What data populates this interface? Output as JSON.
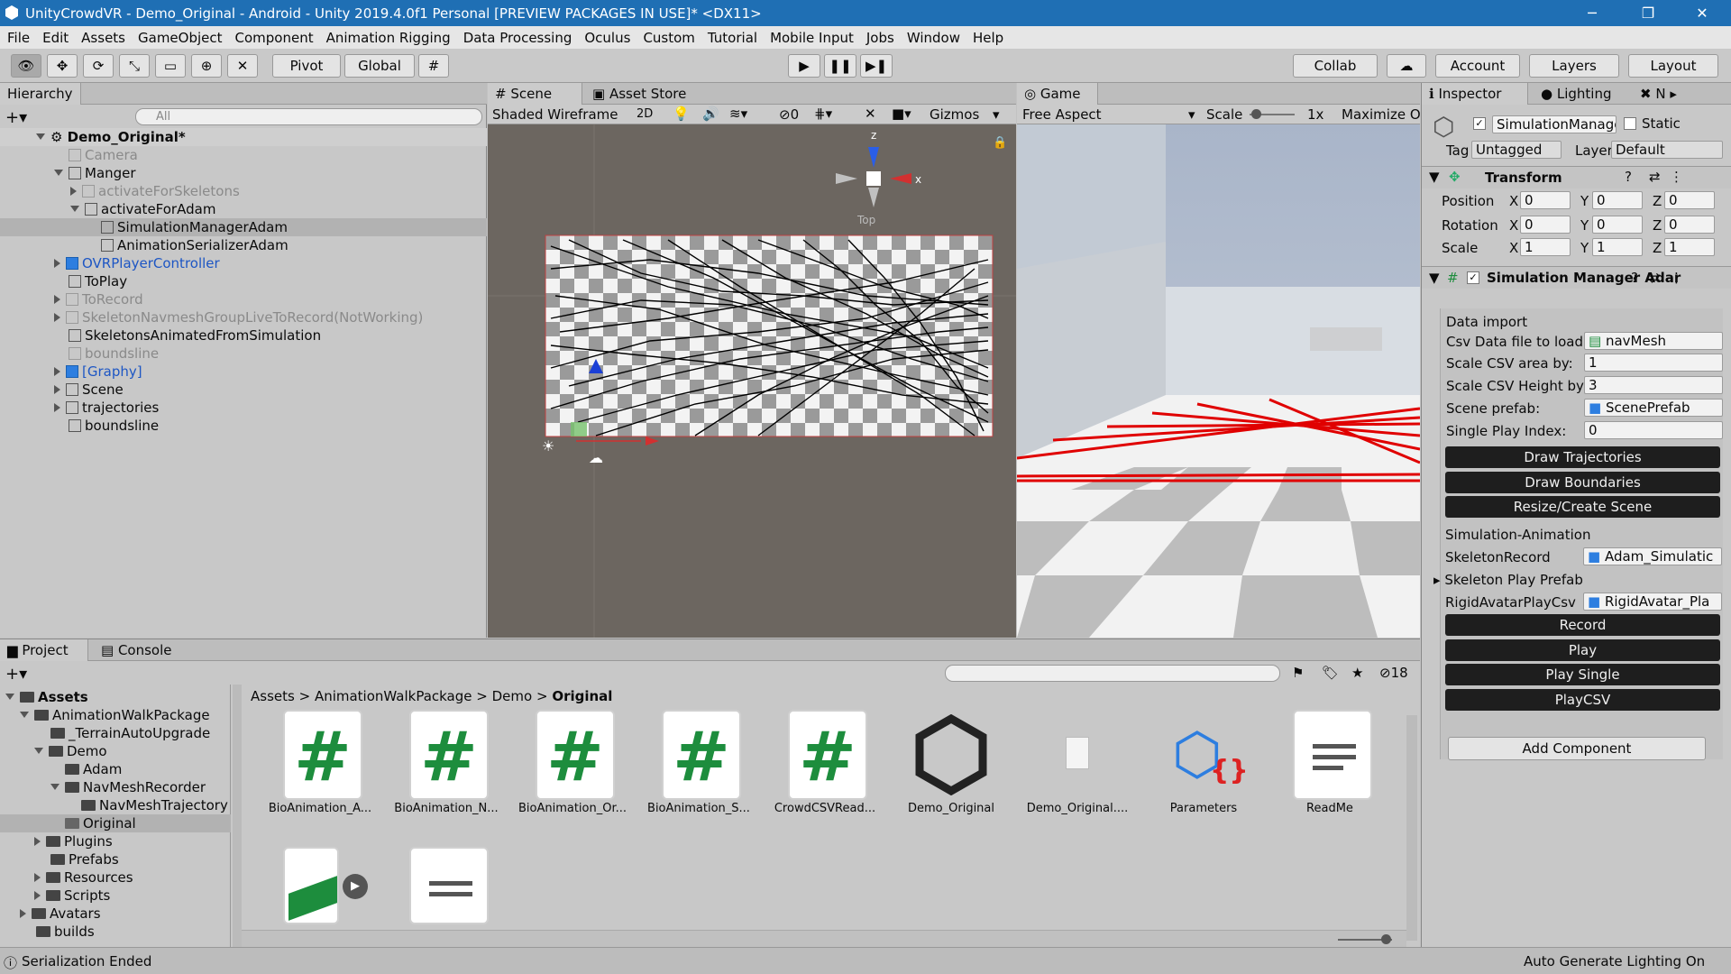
{
  "titlebar": {
    "title": "UnityCrowdVR - Demo_Original - Android - Unity 2019.4.0f1 Personal [PREVIEW PACKAGES IN USE]* <DX11>",
    "minimize": "─",
    "restore": "❐",
    "close": "✕"
  },
  "menu": [
    "File",
    "Edit",
    "Assets",
    "GameObject",
    "Component",
    "Animation Rigging",
    "Data Processing",
    "Oculus",
    "Custom",
    "Tutorial",
    "Mobile Input",
    "Jobs",
    "Window",
    "Help"
  ],
  "toolbar": {
    "pivot": "Pivot",
    "global": "Global",
    "collab": "Collab",
    "account": "Account",
    "layers": "Layers",
    "layout": "Layout"
  },
  "hierarchy": {
    "tab": "Hierarchy",
    "search_placeholder": "All",
    "items": [
      {
        "label": "Demo_Original*",
        "style": "root"
      },
      {
        "label": "Camera",
        "style": "dim"
      },
      {
        "label": "Manger",
        "style": "normal"
      },
      {
        "label": "activateForSkeletons",
        "style": "dim"
      },
      {
        "label": "activateForAdam",
        "style": "normal"
      },
      {
        "label": "SimulationManagerAdam",
        "style": "normal"
      },
      {
        "label": "AnimationSerializerAdam",
        "style": "normal"
      },
      {
        "label": "OVRPlayerController",
        "style": "link"
      },
      {
        "label": "ToPlay",
        "style": "normal"
      },
      {
        "label": "ToRecord",
        "style": "dim"
      },
      {
        "label": "SkeletonNavmeshGroupLiveToRecord(NotWorking)",
        "style": "dim"
      },
      {
        "label": "SkeletonsAnimatedFromSimulation",
        "style": "normal"
      },
      {
        "label": "boundsline",
        "style": "dim"
      },
      {
        "label": "[Graphy]",
        "style": "link"
      },
      {
        "label": "Scene",
        "style": "normal"
      },
      {
        "label": "trajectories",
        "style": "normal"
      },
      {
        "label": "boundsline",
        "style": "normal"
      }
    ]
  },
  "scene": {
    "tab": "Scene",
    "tab2": "Asset Store",
    "shading": "Shaded Wireframe",
    "mode2d": "2D",
    "hidden_count": "0",
    "gizmos": "Gizmos",
    "axis_z": "z",
    "axis_x": "x",
    "view_label": "Top"
  },
  "game": {
    "tab": "Game",
    "aspect": "Free Aspect",
    "scale_label": "Scale",
    "scale_value": "1x",
    "maximize": "Maximize O"
  },
  "inspector": {
    "tab": "Inspector",
    "tab2": "Lighting",
    "tab3": "N",
    "object_name": "SimulationManagerAd",
    "static": "Static",
    "tag_label": "Tag",
    "tag": "Untagged",
    "layer_label": "Layer",
    "layer": "Default",
    "transform": {
      "title": "Transform",
      "rows": [
        {
          "label": "Position",
          "x": "0",
          "y": "0",
          "z": "0"
        },
        {
          "label": "Rotation",
          "x": "0",
          "y": "0",
          "z": "0"
        },
        {
          "label": "Scale",
          "x": "1",
          "y": "1",
          "z": "1"
        }
      ]
    },
    "component": {
      "title": "Simulation Manager Adar",
      "section1": "Data import",
      "csv_label": "Csv Data file to load:",
      "csv_value": "navMesh",
      "area_label": "Scale CSV area by:",
      "area_value": "1",
      "height_label": "Scale CSV Height by",
      "height_value": "3",
      "prefab_label": "Scene prefab:",
      "prefab_value": "ScenePrefab",
      "single_label": "Single Play Index:",
      "single_value": "0",
      "btn_draw_traj": "Draw Trajectories",
      "btn_draw_bound": "Draw Boundaries",
      "btn_resize": "Resize/Create Scene",
      "section2": "Simulation-Animation",
      "skel_label": "SkeletonRecord",
      "skel_value": "Adam_Simulatic",
      "skelplay_label": "Skeleton Play Prefab",
      "rigid_label": "RigidAvatarPlayCsv",
      "rigid_value": "RigidAvatar_Pla",
      "btn_record": "Record",
      "btn_play": "Play",
      "btn_play_single": "Play Single",
      "btn_playcsv": "PlayCSV"
    },
    "add_component": "Add Component"
  },
  "project": {
    "tab": "Project",
    "tab2": "Console",
    "hidden_count": "18",
    "breadcrumb": [
      "Assets",
      "AnimationWalkPackage",
      "Demo",
      "Original"
    ],
    "tree": [
      {
        "label": "Assets",
        "style": "bold"
      },
      {
        "label": "AnimationWalkPackage",
        "style": "normal"
      },
      {
        "label": "_TerrainAutoUpgrade",
        "style": "normal"
      },
      {
        "label": "Demo",
        "style": "normal"
      },
      {
        "label": "Adam",
        "style": "normal"
      },
      {
        "label": "NavMeshRecorder",
        "style": "normal"
      },
      {
        "label": "NavMeshTrajectory",
        "style": "normal"
      },
      {
        "label": "Original",
        "style": "selected"
      },
      {
        "label": "Plugins",
        "style": "normal"
      },
      {
        "label": "Prefabs",
        "style": "normal"
      },
      {
        "label": "Resources",
        "style": "normal"
      },
      {
        "label": "Scripts",
        "style": "normal"
      },
      {
        "label": "Avatars",
        "style": "normal"
      },
      {
        "label": "builds",
        "style": "normal"
      }
    ],
    "assets": [
      "BioAnimation_A...",
      "BioAnimation_N...",
      "BioAnimation_Or...",
      "BioAnimation_S...",
      "CrowdCSVRead...",
      "Demo_Original",
      "Demo_Original....",
      "Parameters",
      "ReadMe"
    ]
  },
  "status": {
    "left": "Serialization Ended",
    "right": "Auto Generate Lighting On"
  }
}
